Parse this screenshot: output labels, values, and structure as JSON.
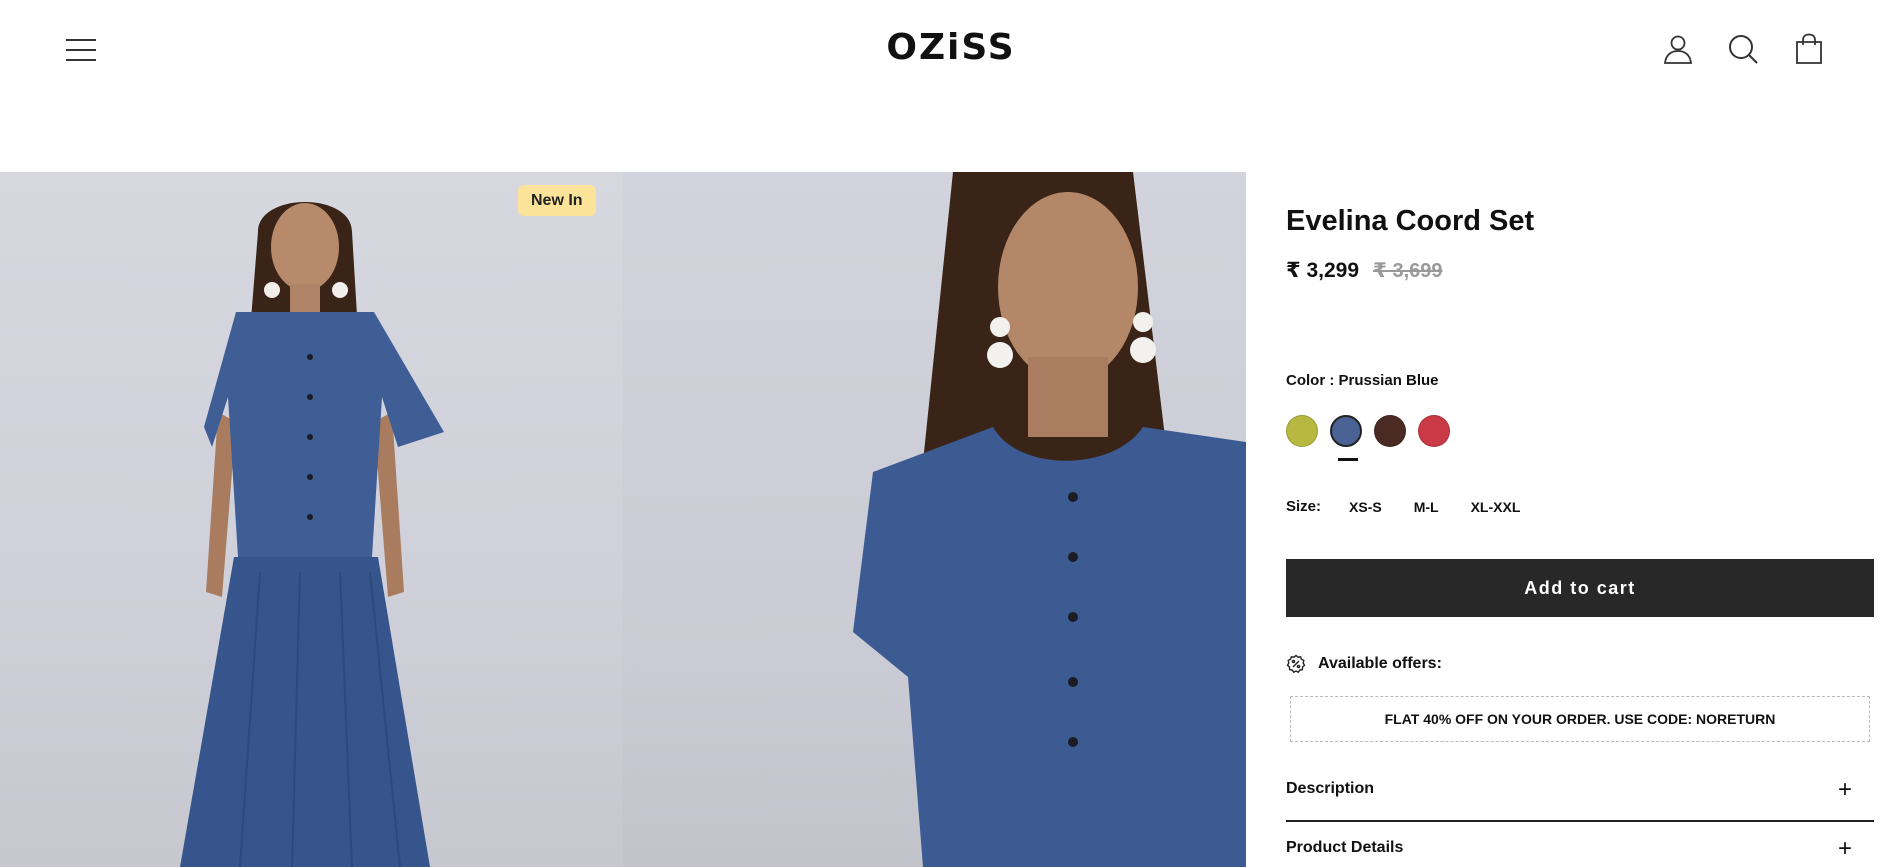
{
  "header": {
    "logo": "OZiSS",
    "icons": [
      "menu-icon",
      "account-icon",
      "search-icon",
      "cart-icon"
    ]
  },
  "gallery": {
    "badge": "New In"
  },
  "product": {
    "title": "Evelina Coord Set",
    "price": "₹ 3,299",
    "compare_price": "₹ 3,699",
    "color_label": "Color : Prussian Blue",
    "swatches": [
      {
        "name": "olive",
        "color": "#b6b840"
      },
      {
        "name": "prussian-blue",
        "color": "#4a6294",
        "selected": true
      },
      {
        "name": "brown",
        "color": "#4a2a22"
      },
      {
        "name": "red",
        "color": "#c93a46"
      }
    ],
    "size_label": "Size:",
    "sizes": [
      "XS-S",
      "M-L",
      "XL-XXL"
    ],
    "add_to_cart": "Add to cart",
    "offers_label": "Available offers:",
    "offer_text": "FLAT 40% OFF ON YOUR ORDER. USE CODE: NORETURN",
    "accordions": [
      {
        "label": "Description",
        "icon": "+"
      },
      {
        "label": "Product Details",
        "icon": "+"
      }
    ]
  },
  "colors": {
    "button_bg": "#282828",
    "badge_bg": "#fbe39a",
    "compare_price": "#9a9a9a"
  }
}
